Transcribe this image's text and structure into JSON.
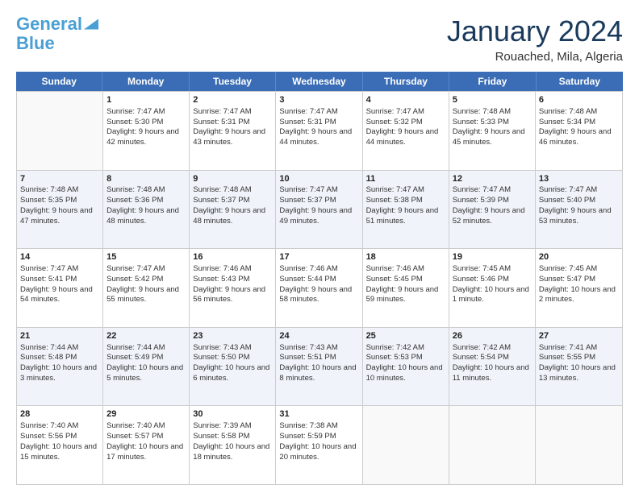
{
  "header": {
    "logo_line1": "General",
    "logo_line2": "Blue",
    "title": "January 2024",
    "location": "Rouached, Mila, Algeria"
  },
  "days_of_week": [
    "Sunday",
    "Monday",
    "Tuesday",
    "Wednesday",
    "Thursday",
    "Friday",
    "Saturday"
  ],
  "weeks": [
    [
      {
        "day": "",
        "sunrise": "",
        "sunset": "",
        "daylight": ""
      },
      {
        "day": "1",
        "sunrise": "Sunrise: 7:47 AM",
        "sunset": "Sunset: 5:30 PM",
        "daylight": "Daylight: 9 hours and 42 minutes."
      },
      {
        "day": "2",
        "sunrise": "Sunrise: 7:47 AM",
        "sunset": "Sunset: 5:31 PM",
        "daylight": "Daylight: 9 hours and 43 minutes."
      },
      {
        "day": "3",
        "sunrise": "Sunrise: 7:47 AM",
        "sunset": "Sunset: 5:31 PM",
        "daylight": "Daylight: 9 hours and 44 minutes."
      },
      {
        "day": "4",
        "sunrise": "Sunrise: 7:47 AM",
        "sunset": "Sunset: 5:32 PM",
        "daylight": "Daylight: 9 hours and 44 minutes."
      },
      {
        "day": "5",
        "sunrise": "Sunrise: 7:48 AM",
        "sunset": "Sunset: 5:33 PM",
        "daylight": "Daylight: 9 hours and 45 minutes."
      },
      {
        "day": "6",
        "sunrise": "Sunrise: 7:48 AM",
        "sunset": "Sunset: 5:34 PM",
        "daylight": "Daylight: 9 hours and 46 minutes."
      }
    ],
    [
      {
        "day": "7",
        "sunrise": "Sunrise: 7:48 AM",
        "sunset": "Sunset: 5:35 PM",
        "daylight": "Daylight: 9 hours and 47 minutes."
      },
      {
        "day": "8",
        "sunrise": "Sunrise: 7:48 AM",
        "sunset": "Sunset: 5:36 PM",
        "daylight": "Daylight: 9 hours and 48 minutes."
      },
      {
        "day": "9",
        "sunrise": "Sunrise: 7:48 AM",
        "sunset": "Sunset: 5:37 PM",
        "daylight": "Daylight: 9 hours and 48 minutes."
      },
      {
        "day": "10",
        "sunrise": "Sunrise: 7:47 AM",
        "sunset": "Sunset: 5:37 PM",
        "daylight": "Daylight: 9 hours and 49 minutes."
      },
      {
        "day": "11",
        "sunrise": "Sunrise: 7:47 AM",
        "sunset": "Sunset: 5:38 PM",
        "daylight": "Daylight: 9 hours and 51 minutes."
      },
      {
        "day": "12",
        "sunrise": "Sunrise: 7:47 AM",
        "sunset": "Sunset: 5:39 PM",
        "daylight": "Daylight: 9 hours and 52 minutes."
      },
      {
        "day": "13",
        "sunrise": "Sunrise: 7:47 AM",
        "sunset": "Sunset: 5:40 PM",
        "daylight": "Daylight: 9 hours and 53 minutes."
      }
    ],
    [
      {
        "day": "14",
        "sunrise": "Sunrise: 7:47 AM",
        "sunset": "Sunset: 5:41 PM",
        "daylight": "Daylight: 9 hours and 54 minutes."
      },
      {
        "day": "15",
        "sunrise": "Sunrise: 7:47 AM",
        "sunset": "Sunset: 5:42 PM",
        "daylight": "Daylight: 9 hours and 55 minutes."
      },
      {
        "day": "16",
        "sunrise": "Sunrise: 7:46 AM",
        "sunset": "Sunset: 5:43 PM",
        "daylight": "Daylight: 9 hours and 56 minutes."
      },
      {
        "day": "17",
        "sunrise": "Sunrise: 7:46 AM",
        "sunset": "Sunset: 5:44 PM",
        "daylight": "Daylight: 9 hours and 58 minutes."
      },
      {
        "day": "18",
        "sunrise": "Sunrise: 7:46 AM",
        "sunset": "Sunset: 5:45 PM",
        "daylight": "Daylight: 9 hours and 59 minutes."
      },
      {
        "day": "19",
        "sunrise": "Sunrise: 7:45 AM",
        "sunset": "Sunset: 5:46 PM",
        "daylight": "Daylight: 10 hours and 1 minute."
      },
      {
        "day": "20",
        "sunrise": "Sunrise: 7:45 AM",
        "sunset": "Sunset: 5:47 PM",
        "daylight": "Daylight: 10 hours and 2 minutes."
      }
    ],
    [
      {
        "day": "21",
        "sunrise": "Sunrise: 7:44 AM",
        "sunset": "Sunset: 5:48 PM",
        "daylight": "Daylight: 10 hours and 3 minutes."
      },
      {
        "day": "22",
        "sunrise": "Sunrise: 7:44 AM",
        "sunset": "Sunset: 5:49 PM",
        "daylight": "Daylight: 10 hours and 5 minutes."
      },
      {
        "day": "23",
        "sunrise": "Sunrise: 7:43 AM",
        "sunset": "Sunset: 5:50 PM",
        "daylight": "Daylight: 10 hours and 6 minutes."
      },
      {
        "day": "24",
        "sunrise": "Sunrise: 7:43 AM",
        "sunset": "Sunset: 5:51 PM",
        "daylight": "Daylight: 10 hours and 8 minutes."
      },
      {
        "day": "25",
        "sunrise": "Sunrise: 7:42 AM",
        "sunset": "Sunset: 5:53 PM",
        "daylight": "Daylight: 10 hours and 10 minutes."
      },
      {
        "day": "26",
        "sunrise": "Sunrise: 7:42 AM",
        "sunset": "Sunset: 5:54 PM",
        "daylight": "Daylight: 10 hours and 11 minutes."
      },
      {
        "day": "27",
        "sunrise": "Sunrise: 7:41 AM",
        "sunset": "Sunset: 5:55 PM",
        "daylight": "Daylight: 10 hours and 13 minutes."
      }
    ],
    [
      {
        "day": "28",
        "sunrise": "Sunrise: 7:40 AM",
        "sunset": "Sunset: 5:56 PM",
        "daylight": "Daylight: 10 hours and 15 minutes."
      },
      {
        "day": "29",
        "sunrise": "Sunrise: 7:40 AM",
        "sunset": "Sunset: 5:57 PM",
        "daylight": "Daylight: 10 hours and 17 minutes."
      },
      {
        "day": "30",
        "sunrise": "Sunrise: 7:39 AM",
        "sunset": "Sunset: 5:58 PM",
        "daylight": "Daylight: 10 hours and 18 minutes."
      },
      {
        "day": "31",
        "sunrise": "Sunrise: 7:38 AM",
        "sunset": "Sunset: 5:59 PM",
        "daylight": "Daylight: 10 hours and 20 minutes."
      },
      {
        "day": "",
        "sunrise": "",
        "sunset": "",
        "daylight": ""
      },
      {
        "day": "",
        "sunrise": "",
        "sunset": "",
        "daylight": ""
      },
      {
        "day": "",
        "sunrise": "",
        "sunset": "",
        "daylight": ""
      }
    ]
  ]
}
